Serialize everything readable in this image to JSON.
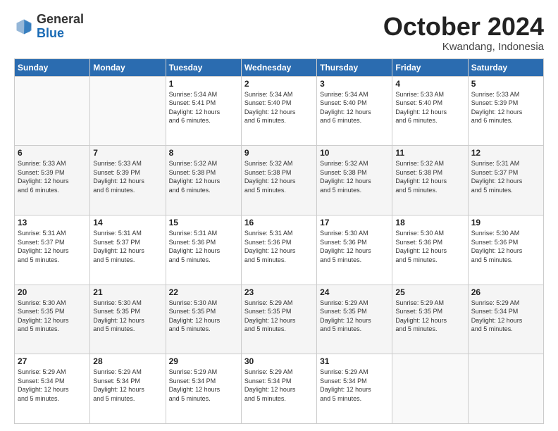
{
  "header": {
    "logo_general": "General",
    "logo_blue": "Blue",
    "month": "October 2024",
    "location": "Kwandang, Indonesia"
  },
  "days_of_week": [
    "Sunday",
    "Monday",
    "Tuesday",
    "Wednesday",
    "Thursday",
    "Friday",
    "Saturday"
  ],
  "weeks": [
    [
      {
        "day": "",
        "info": ""
      },
      {
        "day": "",
        "info": ""
      },
      {
        "day": "1",
        "info": "Sunrise: 5:34 AM\nSunset: 5:41 PM\nDaylight: 12 hours\nand 6 minutes."
      },
      {
        "day": "2",
        "info": "Sunrise: 5:34 AM\nSunset: 5:40 PM\nDaylight: 12 hours\nand 6 minutes."
      },
      {
        "day": "3",
        "info": "Sunrise: 5:34 AM\nSunset: 5:40 PM\nDaylight: 12 hours\nand 6 minutes."
      },
      {
        "day": "4",
        "info": "Sunrise: 5:33 AM\nSunset: 5:40 PM\nDaylight: 12 hours\nand 6 minutes."
      },
      {
        "day": "5",
        "info": "Sunrise: 5:33 AM\nSunset: 5:39 PM\nDaylight: 12 hours\nand 6 minutes."
      }
    ],
    [
      {
        "day": "6",
        "info": "Sunrise: 5:33 AM\nSunset: 5:39 PM\nDaylight: 12 hours\nand 6 minutes."
      },
      {
        "day": "7",
        "info": "Sunrise: 5:33 AM\nSunset: 5:39 PM\nDaylight: 12 hours\nand 6 minutes."
      },
      {
        "day": "8",
        "info": "Sunrise: 5:32 AM\nSunset: 5:38 PM\nDaylight: 12 hours\nand 6 minutes."
      },
      {
        "day": "9",
        "info": "Sunrise: 5:32 AM\nSunset: 5:38 PM\nDaylight: 12 hours\nand 5 minutes."
      },
      {
        "day": "10",
        "info": "Sunrise: 5:32 AM\nSunset: 5:38 PM\nDaylight: 12 hours\nand 5 minutes."
      },
      {
        "day": "11",
        "info": "Sunrise: 5:32 AM\nSunset: 5:38 PM\nDaylight: 12 hours\nand 5 minutes."
      },
      {
        "day": "12",
        "info": "Sunrise: 5:31 AM\nSunset: 5:37 PM\nDaylight: 12 hours\nand 5 minutes."
      }
    ],
    [
      {
        "day": "13",
        "info": "Sunrise: 5:31 AM\nSunset: 5:37 PM\nDaylight: 12 hours\nand 5 minutes."
      },
      {
        "day": "14",
        "info": "Sunrise: 5:31 AM\nSunset: 5:37 PM\nDaylight: 12 hours\nand 5 minutes."
      },
      {
        "day": "15",
        "info": "Sunrise: 5:31 AM\nSunset: 5:36 PM\nDaylight: 12 hours\nand 5 minutes."
      },
      {
        "day": "16",
        "info": "Sunrise: 5:31 AM\nSunset: 5:36 PM\nDaylight: 12 hours\nand 5 minutes."
      },
      {
        "day": "17",
        "info": "Sunrise: 5:30 AM\nSunset: 5:36 PM\nDaylight: 12 hours\nand 5 minutes."
      },
      {
        "day": "18",
        "info": "Sunrise: 5:30 AM\nSunset: 5:36 PM\nDaylight: 12 hours\nand 5 minutes."
      },
      {
        "day": "19",
        "info": "Sunrise: 5:30 AM\nSunset: 5:36 PM\nDaylight: 12 hours\nand 5 minutes."
      }
    ],
    [
      {
        "day": "20",
        "info": "Sunrise: 5:30 AM\nSunset: 5:35 PM\nDaylight: 12 hours\nand 5 minutes."
      },
      {
        "day": "21",
        "info": "Sunrise: 5:30 AM\nSunset: 5:35 PM\nDaylight: 12 hours\nand 5 minutes."
      },
      {
        "day": "22",
        "info": "Sunrise: 5:30 AM\nSunset: 5:35 PM\nDaylight: 12 hours\nand 5 minutes."
      },
      {
        "day": "23",
        "info": "Sunrise: 5:29 AM\nSunset: 5:35 PM\nDaylight: 12 hours\nand 5 minutes."
      },
      {
        "day": "24",
        "info": "Sunrise: 5:29 AM\nSunset: 5:35 PM\nDaylight: 12 hours\nand 5 minutes."
      },
      {
        "day": "25",
        "info": "Sunrise: 5:29 AM\nSunset: 5:35 PM\nDaylight: 12 hours\nand 5 minutes."
      },
      {
        "day": "26",
        "info": "Sunrise: 5:29 AM\nSunset: 5:34 PM\nDaylight: 12 hours\nand 5 minutes."
      }
    ],
    [
      {
        "day": "27",
        "info": "Sunrise: 5:29 AM\nSunset: 5:34 PM\nDaylight: 12 hours\nand 5 minutes."
      },
      {
        "day": "28",
        "info": "Sunrise: 5:29 AM\nSunset: 5:34 PM\nDaylight: 12 hours\nand 5 minutes."
      },
      {
        "day": "29",
        "info": "Sunrise: 5:29 AM\nSunset: 5:34 PM\nDaylight: 12 hours\nand 5 minutes."
      },
      {
        "day": "30",
        "info": "Sunrise: 5:29 AM\nSunset: 5:34 PM\nDaylight: 12 hours\nand 5 minutes."
      },
      {
        "day": "31",
        "info": "Sunrise: 5:29 AM\nSunset: 5:34 PM\nDaylight: 12 hours\nand 5 minutes."
      },
      {
        "day": "",
        "info": ""
      },
      {
        "day": "",
        "info": ""
      }
    ]
  ]
}
